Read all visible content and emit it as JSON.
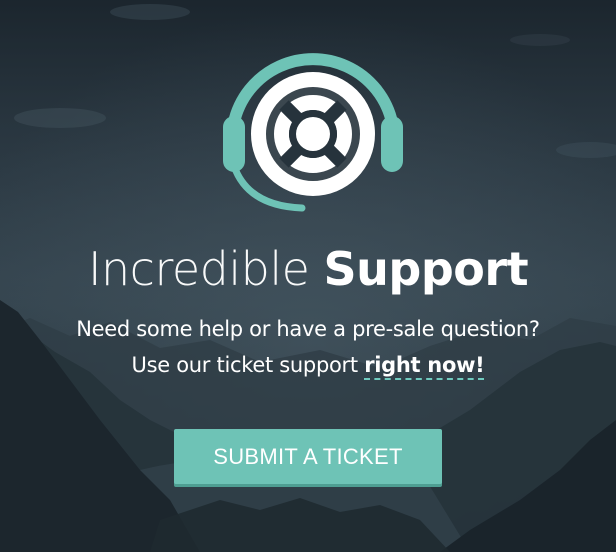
{
  "hero": {
    "headline_light": "Incredible",
    "headline_bold": "Support",
    "line1": "Need some help or have a pre-sale question?",
    "line2_prefix": "Use our ticket support",
    "line2_link": "right now!"
  },
  "cta": {
    "button_label": "SUBMIT A TICKET"
  },
  "icons": {
    "logo": "support-headset-lifebuoy-icon"
  },
  "colors": {
    "accent": "#6ec3b6",
    "text": "#ffffff",
    "background": "#26333c"
  }
}
